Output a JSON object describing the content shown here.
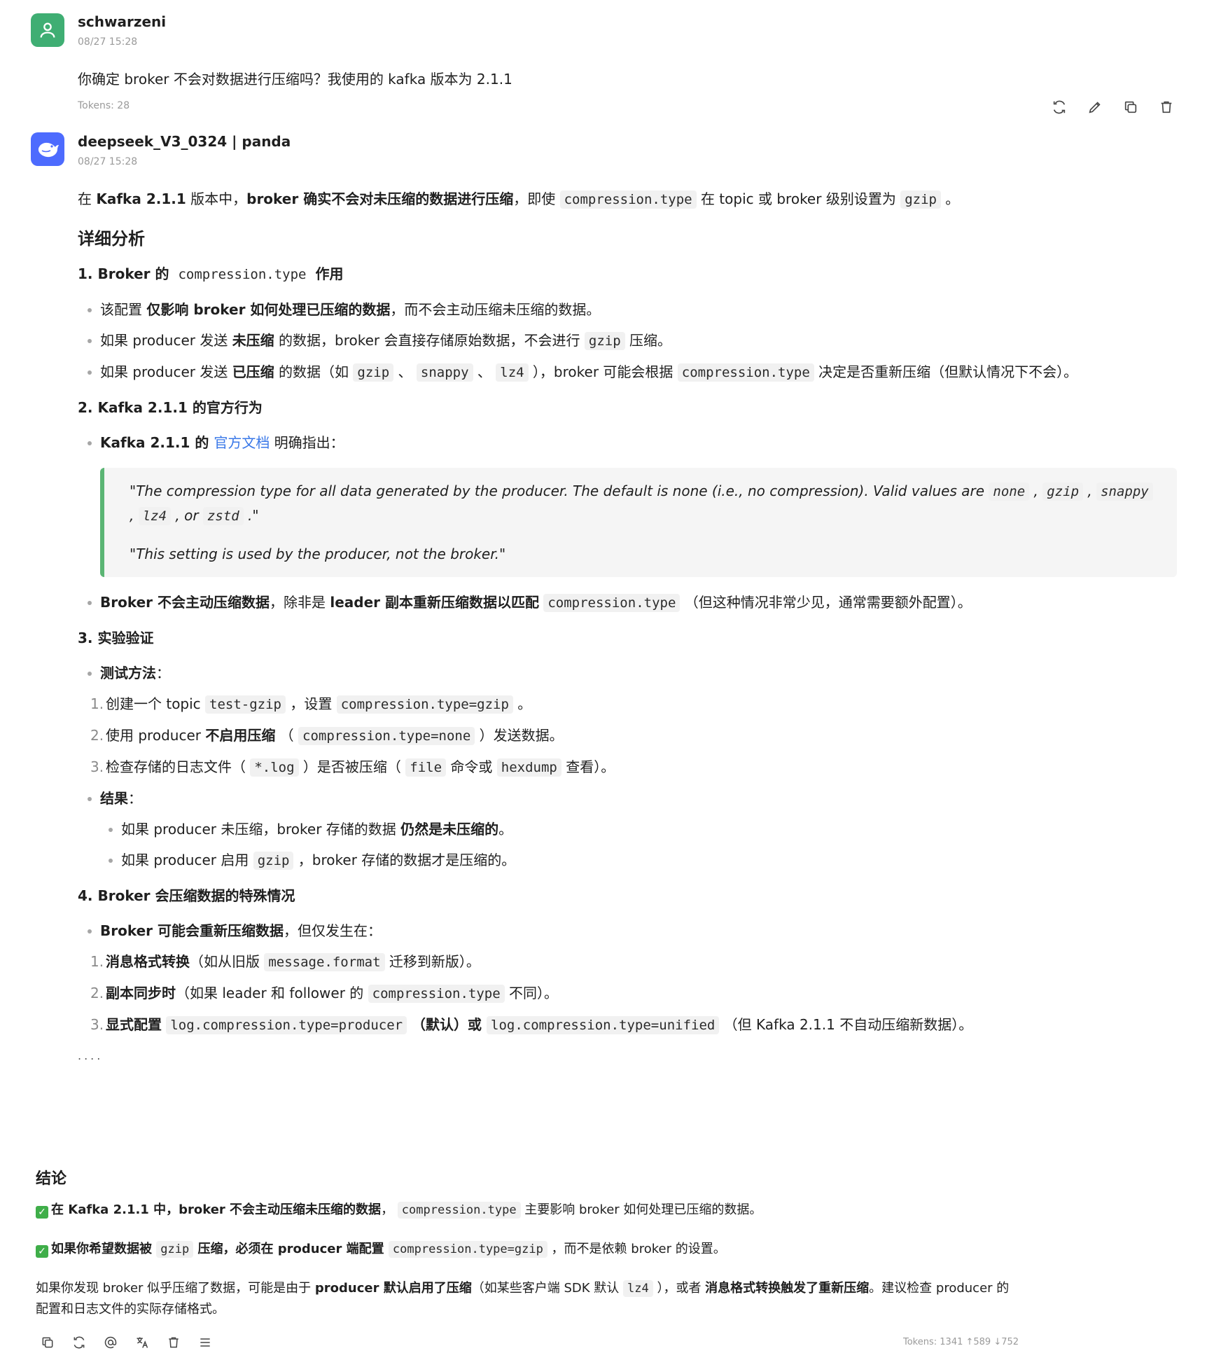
{
  "user_message": {
    "author": "schwarzeni",
    "time": "08/27 15:28",
    "text": "你确定 broker 不会对数据进行压缩吗？我使用的 kafka 版本为 2.1.1",
    "tokens": "Tokens: 28",
    "actions": [
      "refresh-icon",
      "edit-icon",
      "copy-icon",
      "trash-icon"
    ]
  },
  "bot_message": {
    "author": "deepseek_V3_0324 | panda",
    "time": "08/27 15:28",
    "intro": {
      "p1": "在 ",
      "b1": "Kafka 2.1.1",
      "p2": " 版本中，",
      "b2": "broker 确实不会对未压缩的数据进行压缩",
      "p3": "，即使 ",
      "c1": "compression.type",
      "p4": " 在 topic 或 broker 级别设置为 ",
      "c2": "gzip",
      "p5": " 。"
    },
    "heading": "详细分析",
    "s1": {
      "h_a": "1. Broker 的 ",
      "h_code": "compression.type",
      "h_b": " 作用",
      "b1": {
        "a": "该配置 ",
        "b": "仅影响 broker 如何处理已压缩的数据",
        "c": "，而不会主动压缩未压缩的数据。"
      },
      "b2": {
        "a": "如果 producer 发送 ",
        "b": "未压缩",
        "c": " 的数据，broker 会直接存储原始数据，不会进行 ",
        "code": "gzip",
        "d": " 压缩。"
      },
      "b3": {
        "a": "如果 producer 发送 ",
        "b": "已压缩",
        "c": " 的数据（如 ",
        "code1": "gzip",
        "sep1": " 、 ",
        "code2": "snappy",
        "sep2": " 、 ",
        "code3": "lz4",
        "d": " ），broker 可能会根据 ",
        "code4": "compression.type",
        "e": " 决定是否重新压缩（但默认情况下不会）。"
      }
    },
    "s2": {
      "heading": "2. Kafka 2.1.1 的官方行为",
      "b1": {
        "b": "Kafka 2.1.1 的 ",
        "link": "官方文档",
        "c": " 明确指出："
      },
      "quote": {
        "q1a": "\"The compression type for all data generated by the producer. The default is none (i.e., no compression). Valid values are ",
        "qc1": "none",
        "qs1": " , ",
        "qc2": "gzip",
        "qs2": " , ",
        "qc3": "snappy",
        "qs3": " , ",
        "qc4": "lz4",
        "qs4": " , or ",
        "qc5": "zstd",
        "q1b": " .\"",
        "q2": "\"This setting is used by the producer, not the broker.\""
      },
      "b2": {
        "b1": "Broker 不会主动压缩数据",
        "a": "，除非是 ",
        "b2": "leader 副本重新压缩数据以匹配",
        "sp": " ",
        "code": "compression.type",
        "c": " （但这种情况非常少见，通常需要额外配置）。"
      }
    },
    "s3": {
      "heading": "3. 实验验证",
      "method_label": "测试方法",
      "colon": "：",
      "steps": [
        {
          "n": "1.",
          "a": "创建一个 topic ",
          "c1": "test-gzip",
          "b": " ，设置 ",
          "c2": "compression.type=gzip",
          "d": " 。"
        },
        {
          "n": "2.",
          "a": "使用 producer ",
          "bold": "不启用压缩",
          "b": " （ ",
          "c1": "compression.type=none",
          "d": " ）发送数据。"
        },
        {
          "n": "3.",
          "a": "检查存储的日志文件（ ",
          "c1": "*.log",
          "b": " ）是否被压缩（ ",
          "c2": "file",
          "c": " 命令或 ",
          "c3": "hexdump",
          "d": " 查看）。"
        }
      ],
      "result_label": "结果",
      "r1": {
        "a": "如果 producer 未压缩，broker 存储的数据 ",
        "b": "仍然是未压缩的",
        "c": "。"
      },
      "r2": {
        "a": "如果 producer 启用 ",
        "code": "gzip",
        "b": " ，broker 存储的数据才是压缩的。"
      }
    },
    "s4": {
      "heading": "4. Broker 会压缩数据的特殊情况",
      "b1": {
        "b": "Broker 可能会重新压缩数据",
        "a": "，但仅发生在："
      },
      "items": [
        {
          "n": "1.",
          "bold": "消息格式转换",
          "a": "（如从旧版 ",
          "code": "message.format",
          "b": " 迁移到新版）。"
        },
        {
          "n": "2.",
          "bold": "副本同步时",
          "a": "（如果 leader 和 follower 的 ",
          "code": "compression.type",
          "b": " 不同）。"
        },
        {
          "n": "3.",
          "bold": "显式配置",
          "sp": " ",
          "code1": "log.compression.type=producer",
          "mid": " （默认）或 ",
          "code2": "log.compression.type=unified",
          "b": " （但 Kafka 2.1.1 不自动压缩新数据）。"
        }
      ],
      "ellipsis": "...."
    },
    "conclusion": {
      "heading": "结论",
      "l1": {
        "b": "在 Kafka 2.1.1 中，broker 不会主动压缩未压缩的数据",
        "a": "， ",
        "code": "compression.type",
        "c": " 主要影响 broker 如何处理已压缩的数据。"
      },
      "l2": {
        "b1": "如果你希望数据被 ",
        "code1": "gzip",
        "b2": " 压缩，必须在 producer 端配置 ",
        "code2": "compression.type=gzip",
        "a": " ，而不是依赖 broker 的设置。"
      },
      "l3": {
        "a": "如果你发现 broker 似乎压缩了数据，可能是由于 ",
        "b1": "producer 默认启用了压缩",
        "c": "（如某些客户端 SDK 默认 ",
        "code": "lz4",
        "d": " ），或者 ",
        "b2": "消息格式转换触发了重新压缩",
        "e": "。建议检查 producer 的配置和日志文件的实际存储格式。"
      }
    },
    "tokens": "Tokens: 1341 ↑589 ↓752",
    "actions": [
      "copy-icon",
      "refresh-icon",
      "mention-icon",
      "translate-icon",
      "trash-icon",
      "menu-icon"
    ]
  },
  "colors": {
    "user_avatar": "#3fae73",
    "bot_avatar": "#4d6bfe",
    "quote_border": "#5bb574",
    "link": "#3a78e8",
    "check": "#3fae49"
  }
}
